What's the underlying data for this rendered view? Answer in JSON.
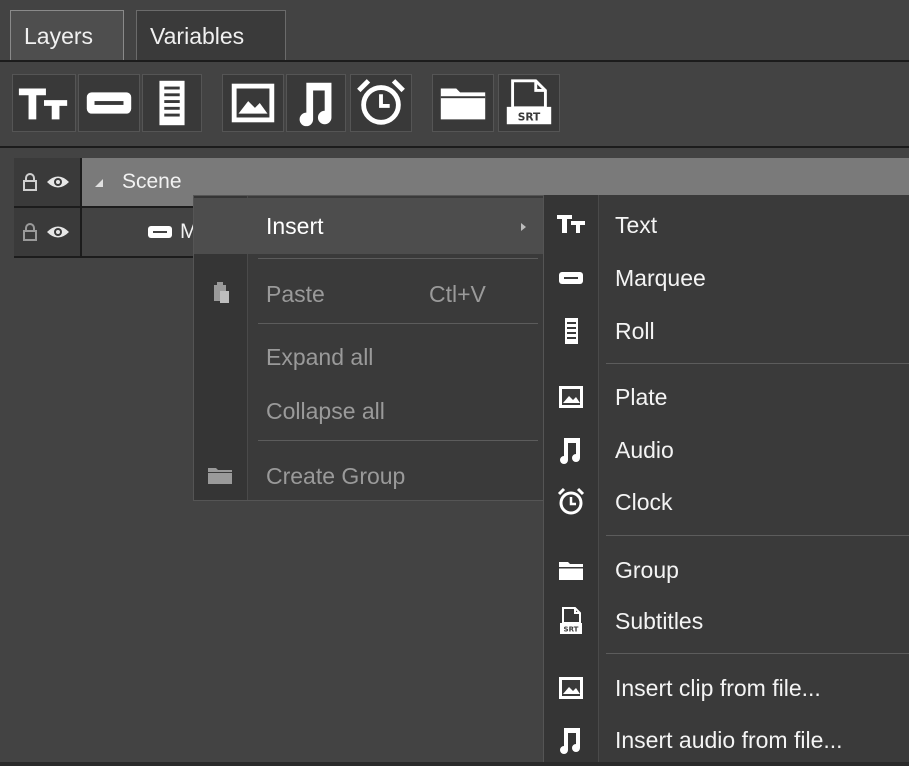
{
  "tabs": [
    {
      "label": "Layers",
      "active": true
    },
    {
      "label": "Variables",
      "active": false
    }
  ],
  "toolbar": {
    "buttons": [
      "text-icon",
      "marquee-icon",
      "roll-icon",
      "plate-icon",
      "audio-icon",
      "clock-icon",
      "group-icon",
      "subtitles-icon"
    ]
  },
  "layers": {
    "scene": {
      "label": "Scene"
    },
    "child": {
      "label": "M"
    }
  },
  "context_menu": {
    "insert": "Insert",
    "paste": "Paste",
    "paste_shortcut": "Ctl+V",
    "expand_all": "Expand all",
    "collapse_all": "Collapse all",
    "create_group": "Create Group"
  },
  "submenu": {
    "items": [
      {
        "label": "Text",
        "icon": "text-icon"
      },
      {
        "label": "Marquee",
        "icon": "marquee-icon"
      },
      {
        "label": "Roll",
        "icon": "roll-icon"
      },
      {
        "label": "Plate",
        "icon": "plate-icon"
      },
      {
        "label": "Audio",
        "icon": "audio-icon"
      },
      {
        "label": "Clock",
        "icon": "clock-icon"
      },
      {
        "label": "Group",
        "icon": "group-icon"
      },
      {
        "label": "Subtitles",
        "icon": "subtitles-icon"
      },
      {
        "label": "Insert clip from file...",
        "icon": "plate-icon"
      },
      {
        "label": "Insert audio from file...",
        "icon": "audio-icon"
      }
    ]
  },
  "colors": {
    "background": "#434343",
    "menu": "#3a3a3a",
    "selected_row": "#7a7a7a",
    "disabled_text": "#9a9a9a"
  }
}
